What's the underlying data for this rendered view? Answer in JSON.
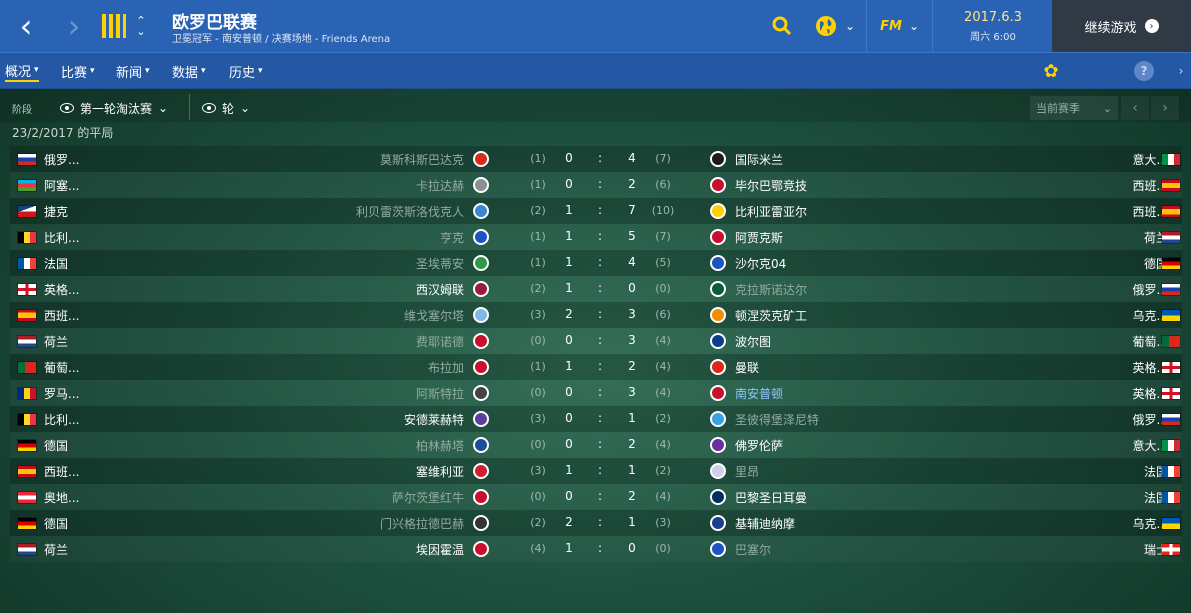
{
  "header": {
    "title": "欧罗巴联赛",
    "subtitle": "卫冕冠军 - 南安普顿 / 决赛场地 - Friends Arena",
    "fm_label": "FM",
    "date": "2017.6.3",
    "time": "周六 6:00",
    "continue_label": "继续游戏"
  },
  "menu": [
    {
      "label": "概况"
    },
    {
      "label": "比赛"
    },
    {
      "label": "新闻"
    },
    {
      "label": "数据"
    },
    {
      "label": "历史"
    }
  ],
  "filters": {
    "stage_label": "阶段",
    "round_filter": "第一轮淘汰赛",
    "leg_filter": "轮",
    "season_label": "当前赛季"
  },
  "avg_label": "23/2/2017 的平局",
  "fixtures": [
    {
      "home_nation": "俄罗...",
      "home_flag": "russia",
      "home_team": "莫斯科斯巴达克",
      "home_agg": "(1)",
      "home_score": "0",
      "colon": ":",
      "away_score": "4",
      "away_agg": "(7)",
      "away_team": "国际米兰",
      "away_nation": "意大...",
      "away_flag": "italy",
      "home_dim": true,
      "away_dim": false
    },
    {
      "home_nation": "阿塞...",
      "home_flag": "azerbaijan",
      "home_team": "卡拉达赫",
      "home_agg": "(1)",
      "home_score": "0",
      "colon": ":",
      "away_score": "2",
      "away_agg": "(6)",
      "away_team": "毕尔巴鄂竞技",
      "away_nation": "西班...",
      "away_flag": "spain",
      "home_dim": true,
      "away_dim": false
    },
    {
      "home_nation": "捷克",
      "home_flag": "czech",
      "home_team": "利贝雷茨斯洛伐克人",
      "home_agg": "(2)",
      "home_score": "1",
      "colon": ":",
      "away_score": "7",
      "away_agg": "(10)",
      "away_team": "比利亚雷亚尔",
      "away_nation": "西班...",
      "away_flag": "spain",
      "home_dim": true,
      "away_dim": false
    },
    {
      "home_nation": "比利...",
      "home_flag": "belgium",
      "home_team": "亨克",
      "home_agg": "(1)",
      "home_score": "1",
      "colon": ":",
      "away_score": "5",
      "away_agg": "(7)",
      "away_team": "阿贾克斯",
      "away_nation": "荷兰",
      "away_flag": "netherlands",
      "home_dim": true,
      "away_dim": false
    },
    {
      "home_nation": "法国",
      "home_flag": "france",
      "home_team": "圣埃蒂安",
      "home_agg": "(1)",
      "home_score": "1",
      "colon": ":",
      "away_score": "4",
      "away_agg": "(5)",
      "away_team": "沙尔克04",
      "away_nation": "德国",
      "away_flag": "germany",
      "home_dim": true,
      "away_dim": false
    },
    {
      "home_nation": "英格...",
      "home_flag": "england",
      "home_team": "西汉姆联",
      "home_agg": "(2)",
      "home_score": "1",
      "colon": ":",
      "away_score": "0",
      "away_agg": "(0)",
      "away_team": "克拉斯诺达尔",
      "away_nation": "俄罗...",
      "away_flag": "russia",
      "home_dim": false,
      "away_dim": true
    },
    {
      "home_nation": "西班...",
      "home_flag": "spain",
      "home_team": "维戈塞尔塔",
      "home_agg": "(3)",
      "home_score": "2",
      "colon": ":",
      "away_score": "3",
      "away_agg": "(6)",
      "away_team": "顿涅茨克矿工",
      "away_nation": "乌克...",
      "away_flag": "ukraine",
      "home_dim": true,
      "away_dim": false
    },
    {
      "home_nation": "荷兰",
      "home_flag": "netherlands",
      "home_team": "费耶诺德",
      "home_agg": "(0)",
      "home_score": "0",
      "colon": ":",
      "away_score": "3",
      "away_agg": "(4)",
      "away_team": "波尔图",
      "away_nation": "葡萄...",
      "away_flag": "portugal",
      "home_dim": true,
      "away_dim": false
    },
    {
      "home_nation": "葡萄...",
      "home_flag": "portugal",
      "home_team": "布拉加",
      "home_agg": "(1)",
      "home_score": "1",
      "colon": ":",
      "away_score": "2",
      "away_agg": "(4)",
      "away_team": "曼联",
      "away_nation": "英格...",
      "away_flag": "england",
      "home_dim": true,
      "away_dim": false
    },
    {
      "home_nation": "罗马...",
      "home_flag": "romania",
      "home_team": "阿斯特拉",
      "home_agg": "(0)",
      "home_score": "0",
      "colon": ":",
      "away_score": "3",
      "away_agg": "(4)",
      "away_team": "南安普顿",
      "away_nation": "英格...",
      "away_flag": "england",
      "home_dim": true,
      "away_dim": false,
      "away_link": true
    },
    {
      "home_nation": "比利...",
      "home_flag": "belgium",
      "home_team": "安德莱赫特",
      "home_agg": "(3)",
      "home_score": "0",
      "colon": ":",
      "away_score": "1",
      "away_agg": "(2)",
      "away_team": "圣彼得堡泽尼特",
      "away_nation": "俄罗...",
      "away_flag": "russia",
      "home_dim": false,
      "away_dim": true
    },
    {
      "home_nation": "德国",
      "home_flag": "germany",
      "home_team": "柏林赫塔",
      "home_agg": "(0)",
      "home_score": "0",
      "colon": ":",
      "away_score": "2",
      "away_agg": "(4)",
      "away_team": "佛罗伦萨",
      "away_nation": "意大...",
      "away_flag": "italy",
      "home_dim": true,
      "away_dim": false
    },
    {
      "home_nation": "西班...",
      "home_flag": "spain",
      "home_team": "塞维利亚",
      "home_agg": "(3)",
      "home_score": "1",
      "colon": ":",
      "away_score": "1",
      "away_agg": "(2)",
      "away_team": "里昂",
      "away_nation": "法国",
      "away_flag": "france",
      "home_dim": false,
      "away_dim": true
    },
    {
      "home_nation": "奥地...",
      "home_flag": "austria",
      "home_team": "萨尔茨堡红牛",
      "home_agg": "(0)",
      "home_score": "0",
      "colon": ":",
      "away_score": "2",
      "away_agg": "(4)",
      "away_team": "巴黎圣日耳曼",
      "away_nation": "法国",
      "away_flag": "france",
      "home_dim": true,
      "away_dim": false
    },
    {
      "home_nation": "德国",
      "home_flag": "germany",
      "home_team": "门兴格拉德巴赫",
      "home_agg": "(2)",
      "home_score": "2",
      "colon": ":",
      "away_score": "1",
      "away_agg": "(3)",
      "away_team": "基辅迪纳摩",
      "away_nation": "乌克...",
      "away_flag": "ukraine",
      "home_dim": true,
      "away_dim": false
    },
    {
      "home_nation": "荷兰",
      "home_flag": "netherlands",
      "home_team": "埃因霍温",
      "home_agg": "(4)",
      "home_score": "1",
      "colon": ":",
      "away_score": "0",
      "away_agg": "(0)",
      "away_team": "巴塞尔",
      "away_nation": "瑞士",
      "away_flag": "switzerland",
      "home_dim": false,
      "away_dim": true
    }
  ],
  "colors": {
    "topbar": "#2a63b4",
    "accent": "#ffd100",
    "link": "#8ec5ff",
    "dim_text": "#93aca2"
  },
  "icons": [
    "back-icon",
    "forward-icon",
    "competition-logo-icon",
    "search-icon",
    "globe-icon",
    "flower-icon",
    "help-icon",
    "eye-icon",
    "chevron-down-icon"
  ]
}
